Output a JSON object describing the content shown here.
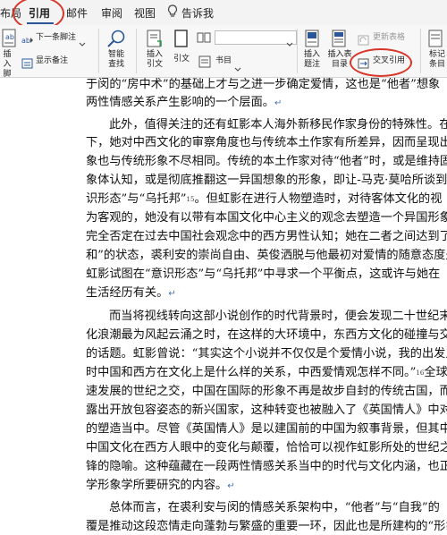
{
  "ribbon": {
    "tabs": [
      {
        "label": "布局"
      },
      {
        "label": "引用"
      },
      {
        "label": "邮件"
      },
      {
        "label": "审阅"
      },
      {
        "label": "视图"
      },
      {
        "label": "告诉我"
      }
    ],
    "buttons": {
      "insert_footnote": "插入\n脚注",
      "next_footnote": "下一条脚注",
      "show_notes": "显示备注",
      "smart_lookup": "智能\n查找",
      "insert_citation": "插入\n引文",
      "citation": "引文",
      "bibliography": "书目",
      "insert_caption": "插入\n题注",
      "insert_table_of_figures": "插入表\n目录",
      "update_table": "更新表格",
      "cross_reference": "交叉引用",
      "mark_entry": "标记\n条目"
    }
  },
  "document": {
    "lines": [
      "于闵的“房中术”的基础上才与之进一步确定爱情，这也是“他者”想象",
      "两性情感关系产生影响的一个层面。",
      "此外，值得关注的还有虹影本人海外新移民作家身份的特殊性。在这",
      "下，她对中西文化的审察角度也与传统本土作家有所差异，因而呈现出的",
      "象也与传统形象不尽相同。传统的本土作家对待“他者”时，或是维持固",
      "象体认知，或是彻底推翻这一异国想象的形象，即让-马克·莫哈所谈到",
      "识形态”与“乌托邦”",
      "。但虹影在进行人物塑造时，对待客体文化的视",
      "为客观的，她没有以带有本国文化中心主义的观念去塑造一个异国形象，",
      "完全否定在过去中国社会观念中的西方男性认知；她在二者之间达到了一",
      "和”的状态，裘利安的崇尚自由、英俊洒脱与他最初对爱情的随意态度是并",
      "虹影试图在“意识形态”与“乌托邦”中寻求一个平衡点，这或许与她在",
      "生活经历有关。",
      "而当将视线转向这部小说创作的时代背景时，便会发现二十世纪末正",
      "化浪潮最为风起云涌之时，在这样的大环境中，东西方文化的碰撞与交流",
      "的话题。虹影曾说：“其实这个小说并不仅仅是个爱情小说，我的出发点",
      "时中国和西方在文化上是什么样的关系，中西爱情观怎样不同。”",
      "全球化",
      "速发展的世纪之交，中国在国际的形象不再是故步自封的传统古国，而是",
      "露出开放包容姿态的新兴国家，这种转变也被融入了《英国情人》中对于",
      "的塑造当中。尽管《英国情人》是以建国前的中国为叙事背景，但其中所",
      "中国文化在西方人眼中的变化与颠覆，恰恰可以视作虹影所处的世纪之交",
      "锋的隐喻。这种蕴藏在一段两性情感关系当中的时代与文化内涵，也正是",
      "学形象学所要研究的内容。",
      "总体而言，在裘利安与闵的情感关系架构中，“他者”与“自我”的",
      "覆是推动这段恋情走向蓬勃与繁盛的重要一环，因此也是所建构的“形象"
    ],
    "footnote_15": "15",
    "footnote_16": "16",
    "para_mark": "↵"
  },
  "colors": {
    "accent": "#2b579a",
    "annotation": "#d9362a",
    "ribbon_bg": "#f7f7f7"
  }
}
